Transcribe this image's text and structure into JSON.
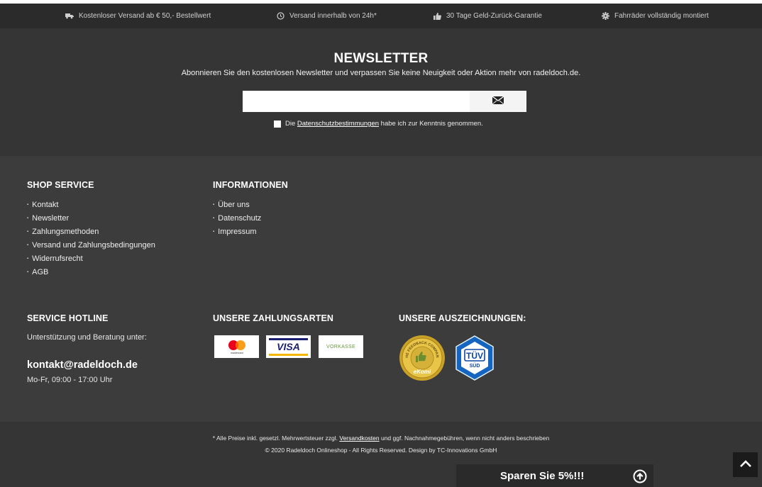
{
  "usp_bar": [
    {
      "icon": "truck-icon",
      "text": "Kostenloser Versand ab € 50,- Bestellwert"
    },
    {
      "icon": "clock-icon",
      "text": "Versand innerhalb von 24h*"
    },
    {
      "icon": "thumbs-up-icon",
      "text": "30 Tage Geld-Zurück-Garantie"
    },
    {
      "icon": "gear-icon",
      "text": "Fahrräder vollständig montiert"
    }
  ],
  "newsletter": {
    "title": "NEWSLETTER",
    "subtitle": "Abonnieren Sie den kostenlosen Newsletter und verpassen Sie keine Neuigkeit oder Aktion mehr von radeldoch.de.",
    "input_value": "",
    "consent_prefix": "Die ",
    "consent_link": "Datenschutzbestimmungen",
    "consent_suffix": " habe ich zur Kenntnis genommen."
  },
  "shop_service": {
    "title": "SHOP SERVICE",
    "items": [
      "Kontakt",
      "Newsletter",
      "Zahlungsmethoden",
      "Versand und Zahlungsbedingungen",
      "Widerrufsrecht",
      "AGB"
    ]
  },
  "informationen": {
    "title": "INFORMATIONEN",
    "items": [
      "Über uns",
      "Datenschutz",
      "Impressum"
    ]
  },
  "hotline": {
    "title": "SERVICE HOTLINE",
    "text": "Unterstützung und Beratung unter:",
    "email": "kontakt@radeldoch.de",
    "hours": "Mo-Fr, 09:00 - 17:00 Uhr"
  },
  "payment": {
    "title": "UNSERE ZAHLUNGSARTEN",
    "logos": [
      "mastercard",
      "VISA",
      "VORKASSE"
    ]
  },
  "awards": {
    "title": "UNSERE AUSZEICHNUNGEN:",
    "ekomi_top": "THE FEEDBACK COMPANY",
    "ekomi_brand": "eKomi",
    "tuv_top": "TÜV",
    "tuv_bottom": "SÜD"
  },
  "legal": {
    "line1_prefix": "* Alle Preise inkl. gesetzl. Mehrwertsteuer zzgl. ",
    "line1_link": "Versandkosten",
    "line1_suffix": " und ggf. Nachnahmegebühren, wenn nicht anders beschrieben",
    "line2": "© 2020 Radeldoch Onlineshop - All Rights Reserved. Design by TC-Innovations GmbH"
  },
  "promo": {
    "label": "Sparen Sie 5%!!!"
  },
  "colors": {
    "topbar": "#2b2b2b",
    "newsletter_bg": "#353535",
    "footer_bg": "#3c3c3c",
    "bottom_bg": "#353535"
  }
}
